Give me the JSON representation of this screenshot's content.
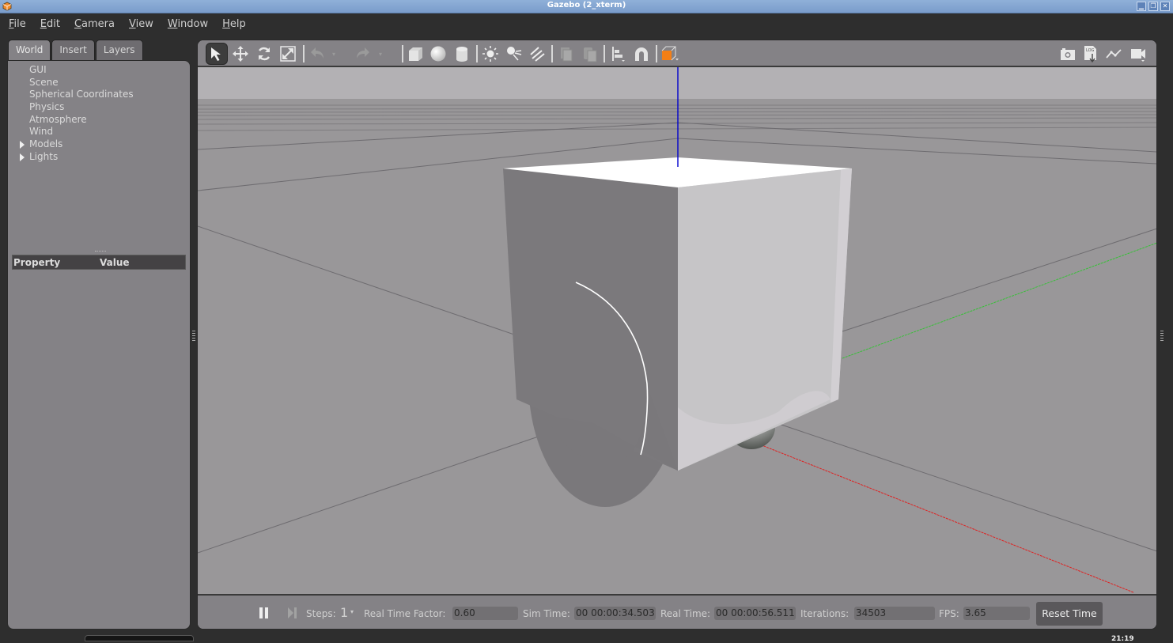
{
  "window": {
    "title": "Gazebo (2_xterm)",
    "controls": [
      "minimize",
      "maximize",
      "close"
    ]
  },
  "menubar": {
    "items": [
      {
        "label": "File",
        "mnemonic": "F",
        "rest": "ile"
      },
      {
        "label": "Edit",
        "mnemonic": "E",
        "rest": "dit"
      },
      {
        "label": "Camera",
        "mnemonic": "C",
        "rest": "amera"
      },
      {
        "label": "View",
        "mnemonic": "V",
        "rest": "iew"
      },
      {
        "label": "Window",
        "mnemonic": "W",
        "rest": "indow"
      },
      {
        "label": "Help",
        "mnemonic": "H",
        "rest": "elp"
      }
    ]
  },
  "left_panel": {
    "tabs": [
      {
        "label": "World",
        "active": true
      },
      {
        "label": "Insert",
        "active": false
      },
      {
        "label": "Layers",
        "active": false
      }
    ],
    "tree": [
      {
        "label": "GUI",
        "expandable": false
      },
      {
        "label": "Scene",
        "expandable": false
      },
      {
        "label": "Spherical Coordinates",
        "expandable": false
      },
      {
        "label": "Physics",
        "expandable": false
      },
      {
        "label": "Atmosphere",
        "expandable": false
      },
      {
        "label": "Wind",
        "expandable": false
      },
      {
        "label": "Models",
        "expandable": true
      },
      {
        "label": "Lights",
        "expandable": true
      }
    ],
    "property_table": {
      "headers": [
        "Property",
        "Value"
      ],
      "rows": []
    }
  },
  "toolbar": {
    "left_tools": [
      {
        "name": "select-mode",
        "icon": "arrow-pointer-icon",
        "active": true
      },
      {
        "name": "translate-mode",
        "icon": "move-arrows-icon"
      },
      {
        "name": "rotate-mode",
        "icon": "rotate-icon"
      },
      {
        "name": "scale-mode",
        "icon": "scale-icon"
      },
      {
        "name": "undo",
        "icon": "undo-icon",
        "disabled": true
      },
      {
        "name": "redo",
        "icon": "redo-icon",
        "disabled": true
      },
      {
        "name": "box",
        "icon": "box-shape-icon"
      },
      {
        "name": "sphere",
        "icon": "sphere-shape-icon"
      },
      {
        "name": "cylinder",
        "icon": "cylinder-shape-icon"
      },
      {
        "name": "point-light",
        "icon": "point-light-icon"
      },
      {
        "name": "spot-light",
        "icon": "spot-light-icon"
      },
      {
        "name": "directional-light",
        "icon": "directional-light-icon"
      },
      {
        "name": "copy",
        "icon": "copy-icon",
        "disabled": true
      },
      {
        "name": "paste",
        "icon": "paste-icon",
        "disabled": true
      },
      {
        "name": "align",
        "icon": "align-icon"
      },
      {
        "name": "snap",
        "icon": "magnet-icon"
      },
      {
        "name": "view-angle",
        "icon": "view-cube-icon"
      }
    ],
    "right_tools": [
      {
        "name": "screenshot",
        "icon": "camera-icon"
      },
      {
        "name": "log",
        "icon": "log-icon",
        "text": "LOG"
      },
      {
        "name": "plot",
        "icon": "plot-icon"
      },
      {
        "name": "record-video",
        "icon": "video-camera-icon"
      }
    ],
    "accent_color": "#f47f16"
  },
  "scene": {
    "axis_colors": {
      "x": "#e02020",
      "y": "#30c030",
      "z": "#0000cc"
    },
    "background": "#999799",
    "sky": "#b3b1b4"
  },
  "bottom_bar": {
    "steps_label": "Steps:",
    "steps_value": "1",
    "rtf_label": "Real Time Factor:",
    "rtf_value": "0.60",
    "sim_time_label": "Sim Time:",
    "sim_time_value": "00 00:00:34.503",
    "real_time_label": "Real Time:",
    "real_time_value": "00 00:00:56.511",
    "iterations_label": "Iterations:",
    "iterations_value": "34503",
    "fps_label": "FPS:",
    "fps_value": "3.65",
    "reset_button": "Reset Time"
  },
  "taskbar": {
    "clock_fragment": "21:19"
  }
}
